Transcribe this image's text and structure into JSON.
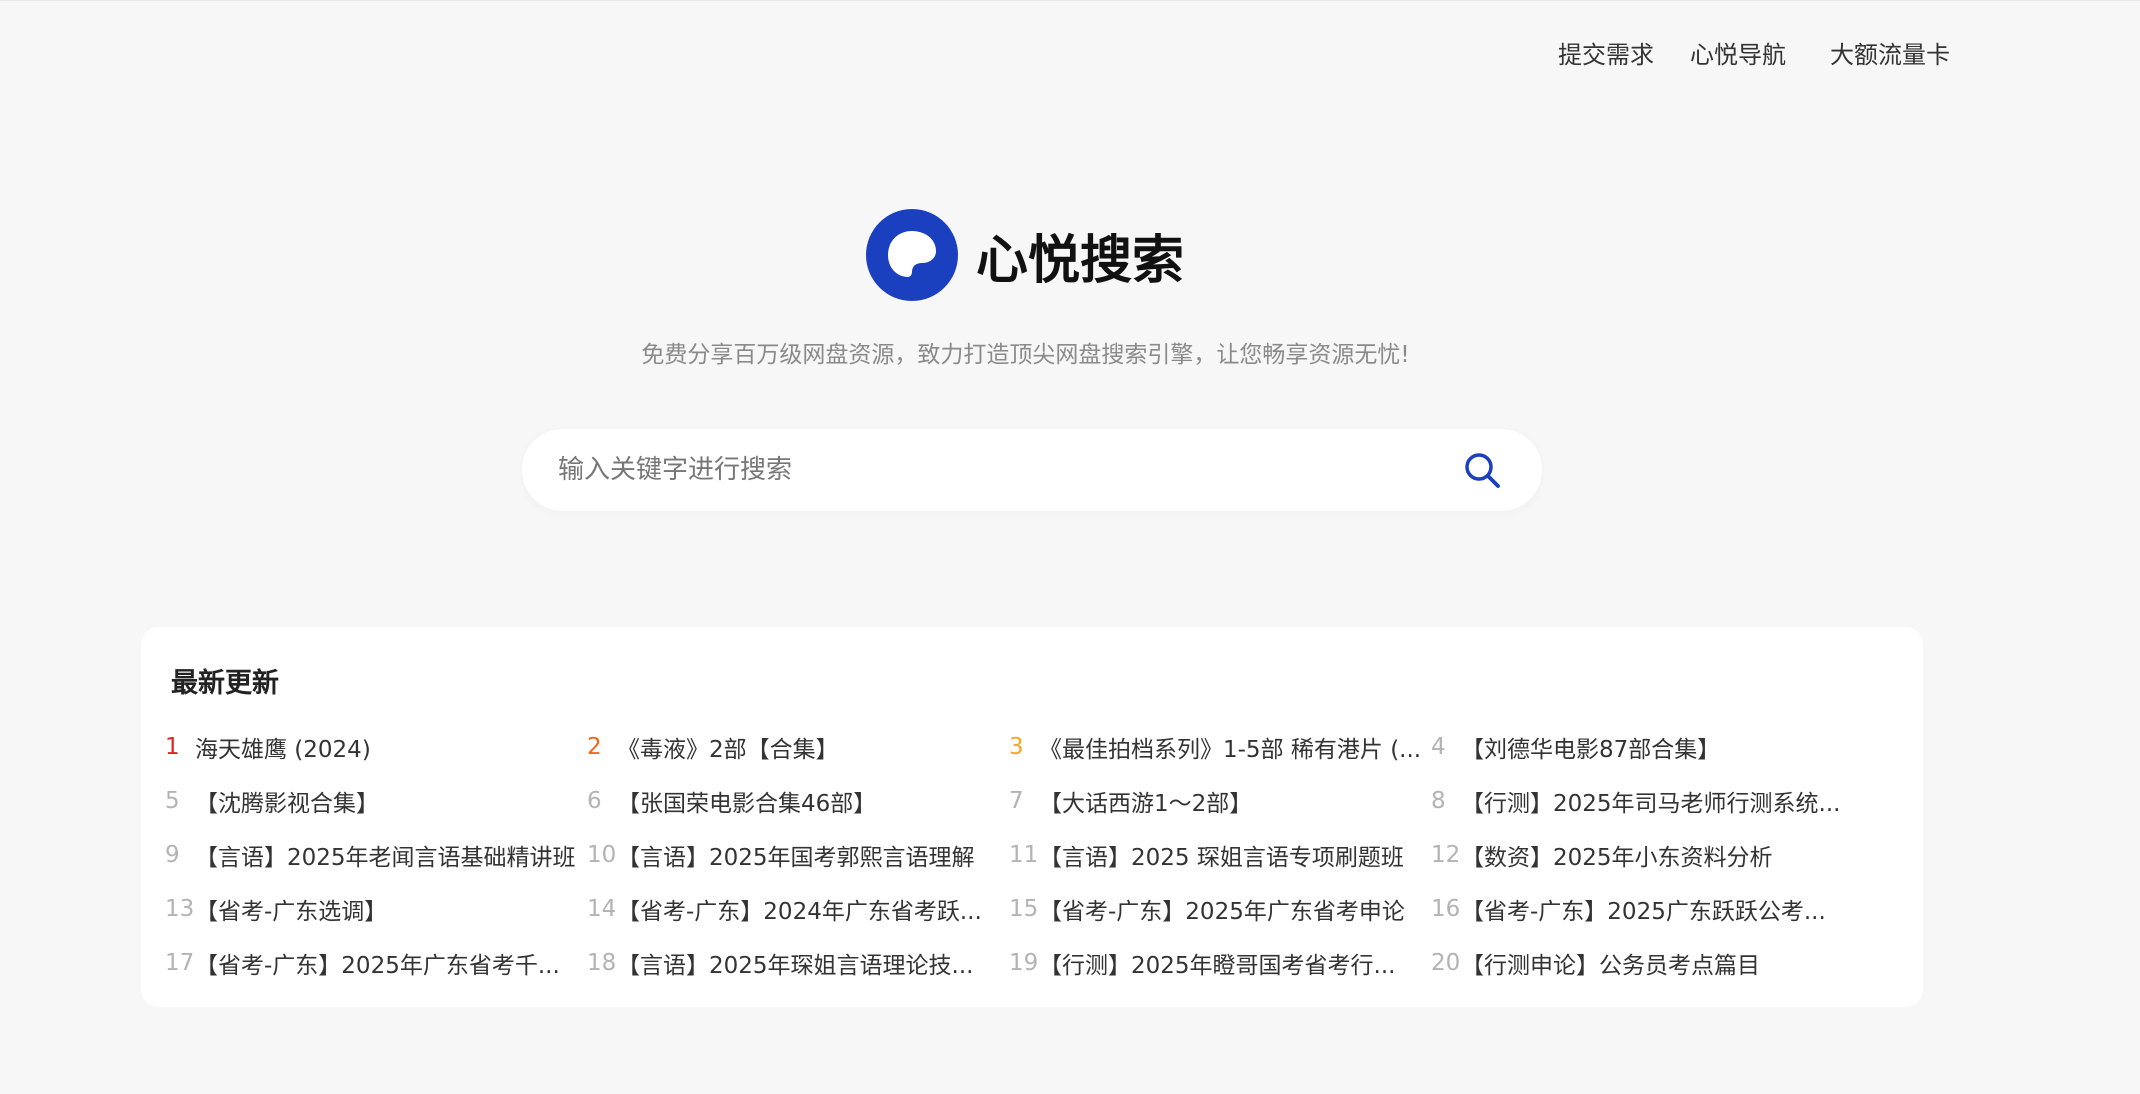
{
  "nav": {
    "links": [
      "提交需求",
      "心悦导航",
      "大额流量卡"
    ]
  },
  "logo": {
    "text": "心悦搜索",
    "brand_color": "#1a3fbf"
  },
  "slogan": "免费分享百万级网盘资源，致力打造顶尖网盘搜索引擎，让您畅享资源无忧!",
  "search": {
    "placeholder": "输入关键字进行搜索",
    "value": "",
    "icon": "search-icon"
  },
  "latest": {
    "title": "最新更新",
    "rank_colors": {
      "1": "#e02424",
      "2": "#f2651d",
      "3": "#f5a623",
      "default": "#b3b3b3"
    },
    "items": [
      {
        "rank": "1",
        "title": "海天雄鹰 (2024)"
      },
      {
        "rank": "2",
        "title": "《毒液》2部【合集】"
      },
      {
        "rank": "3",
        "title": "《最佳拍档系列》1-5部 稀有港片 (..."
      },
      {
        "rank": "4",
        "title": "【刘德华电影87部合集】"
      },
      {
        "rank": "5",
        "title": "【沈腾影视合集】"
      },
      {
        "rank": "6",
        "title": "【张国荣电影合集46部】"
      },
      {
        "rank": "7",
        "title": "【大话西游1～2部】"
      },
      {
        "rank": "8",
        "title": "【行测】2025年司马老师行测系统..."
      },
      {
        "rank": "9",
        "title": "【言语】2025年老闻言语基础精讲班"
      },
      {
        "rank": "10",
        "title": "【言语】2025年国考郭熙言语理解"
      },
      {
        "rank": "11",
        "title": "【言语】2025 琛姐言语专项刷题班"
      },
      {
        "rank": "12",
        "title": "【数资】2025年小东资料分析"
      },
      {
        "rank": "13",
        "title": "【省考-广东选调】"
      },
      {
        "rank": "14",
        "title": "【省考-广东】2024年广东省考跃..."
      },
      {
        "rank": "15",
        "title": "【省考-广东】2025年广东省考申论"
      },
      {
        "rank": "16",
        "title": "【省考-广东】2025广东跃跃公考..."
      },
      {
        "rank": "17",
        "title": "【省考-广东】2025年广东省考千..."
      },
      {
        "rank": "18",
        "title": "【言语】2025年琛姐言语理论技..."
      },
      {
        "rank": "19",
        "title": "【行测】2025年瞪哥国考省考行..."
      },
      {
        "rank": "20",
        "title": "【行测申论】公务员考点篇目"
      }
    ]
  }
}
